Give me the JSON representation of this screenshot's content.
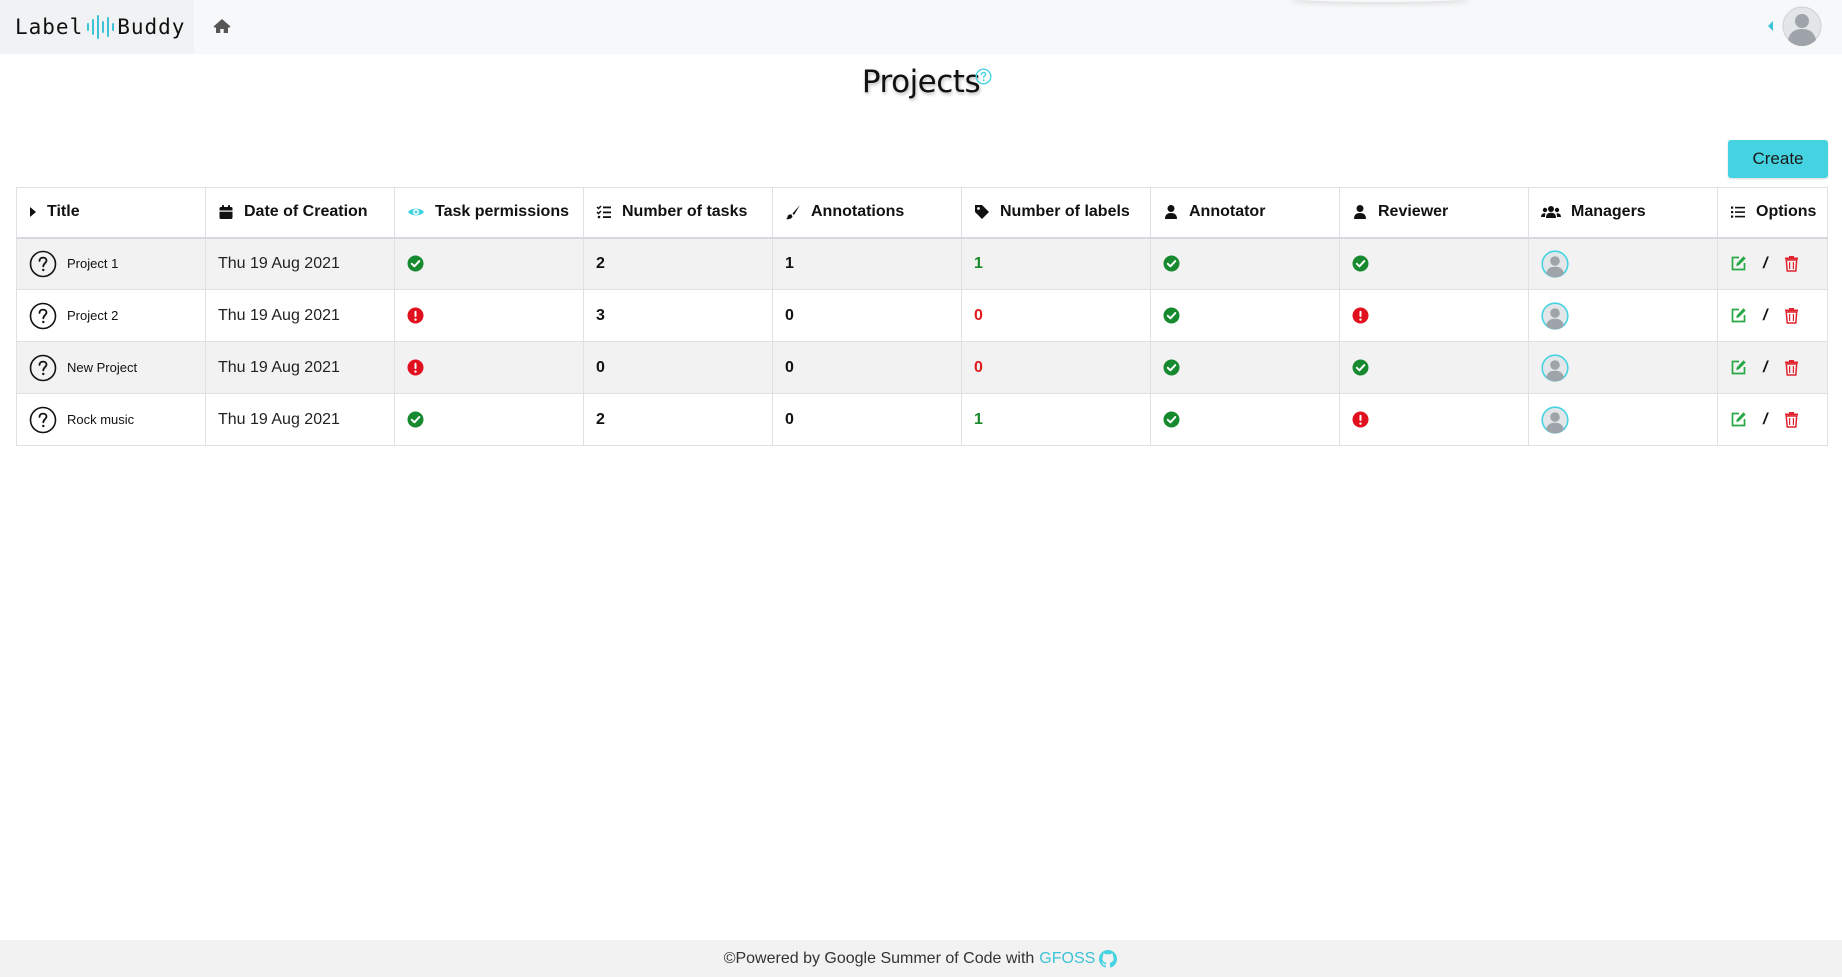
{
  "brand": {
    "left": "Label",
    "right": "Buddy"
  },
  "page": {
    "title": "Projects",
    "create_label": "Create"
  },
  "colors": {
    "accent": "#45d3e1",
    "success": "#1a8a2a",
    "danger": "#e01a1a"
  },
  "table": {
    "headers": [
      {
        "label": "Title",
        "icon": "caret-right-icon"
      },
      {
        "label": "Date of Creation",
        "icon": "calendar-icon"
      },
      {
        "label": "Task permissions",
        "icon": "eye-icon"
      },
      {
        "label": "Number of tasks",
        "icon": "tasks-icon"
      },
      {
        "label": "Annotations",
        "icon": "brush-icon"
      },
      {
        "label": "Number of labels",
        "icon": "tag-icon"
      },
      {
        "label": "Annotator",
        "icon": "user-icon"
      },
      {
        "label": "Reviewer",
        "icon": "user-icon"
      },
      {
        "label": "Managers",
        "icon": "users-icon"
      },
      {
        "label": "Options",
        "icon": "list-icon"
      }
    ],
    "rows": [
      {
        "title": "Project 1",
        "date": "Thu 19 Aug 2021",
        "task_permissions": "ok",
        "tasks": "2",
        "annotations": "1",
        "labels": "1",
        "labels_status": "green",
        "annotator": "ok",
        "reviewer": "ok"
      },
      {
        "title": "Project 2",
        "date": "Thu 19 Aug 2021",
        "task_permissions": "error",
        "tasks": "3",
        "annotations": "0",
        "labels": "0",
        "labels_status": "red",
        "annotator": "ok",
        "reviewer": "error"
      },
      {
        "title": "New Project",
        "date": "Thu 19 Aug 2021",
        "task_permissions": "error",
        "tasks": "0",
        "annotations": "0",
        "labels": "0",
        "labels_status": "red",
        "annotator": "ok",
        "reviewer": "ok"
      },
      {
        "title": "Rock music",
        "date": "Thu 19 Aug 2021",
        "task_permissions": "ok",
        "tasks": "2",
        "annotations": "0",
        "labels": "1",
        "labels_status": "green",
        "annotator": "ok",
        "reviewer": "error"
      }
    ],
    "options_separator": "/"
  },
  "footer": {
    "text": "©Powered by Google Summer of Code with",
    "link": "GFOSS"
  }
}
